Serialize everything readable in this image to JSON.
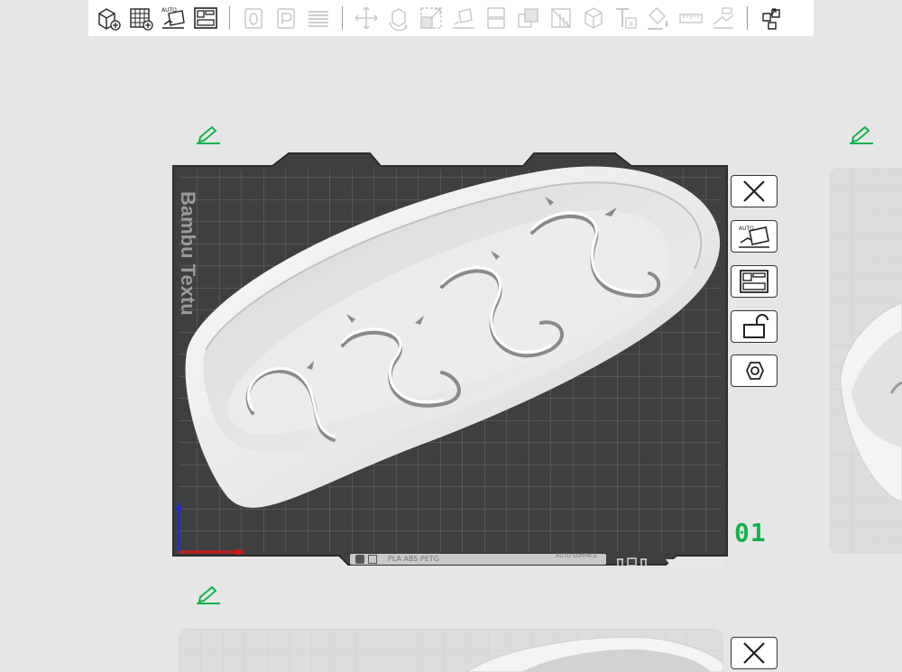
{
  "toolbar": {
    "buttons": [
      {
        "icon": "add-cube-icon",
        "enabled": true
      },
      {
        "icon": "add-plate-icon",
        "enabled": true
      },
      {
        "icon": "auto-orient-icon",
        "enabled": true,
        "text": "AUTO"
      },
      {
        "icon": "arrange-icon",
        "enabled": true
      },
      {
        "icon": "split-objects-icon",
        "enabled": false
      },
      {
        "icon": "split-parts-icon",
        "enabled": false
      },
      {
        "icon": "layers-icon",
        "enabled": false
      },
      {
        "icon": "move-icon",
        "enabled": false
      },
      {
        "icon": "rotate-icon",
        "enabled": false
      },
      {
        "icon": "scale-icon",
        "enabled": false
      },
      {
        "icon": "lay-on-face-icon",
        "enabled": false
      },
      {
        "icon": "cut-icon",
        "enabled": false
      },
      {
        "icon": "boolean-icon",
        "enabled": false
      },
      {
        "icon": "support-paint-icon",
        "enabled": false
      },
      {
        "icon": "seam-paint-icon",
        "enabled": false
      },
      {
        "icon": "text-emboss-icon",
        "enabled": false
      },
      {
        "icon": "color-paint-icon",
        "enabled": false
      },
      {
        "icon": "measure-icon",
        "enabled": false
      },
      {
        "icon": "assembly-icon",
        "enabled": false
      },
      {
        "icon": "explode-view-icon",
        "enabled": true
      }
    ]
  },
  "plate": {
    "label": "Bambu Textu",
    "number": "01",
    "number_color": "#16b14a",
    "filaments_text": "PLA ABS PETG",
    "mode_text": "AUTO SURFACE"
  },
  "plate_buttons": [
    {
      "icon": "close-icon"
    },
    {
      "icon": "auto-orient-icon",
      "text": "AUTO"
    },
    {
      "icon": "arrange-icon"
    },
    {
      "icon": "unlock-icon"
    },
    {
      "icon": "plate-settings-icon"
    }
  ],
  "colors": {
    "accent_green": "#16b14a",
    "bed_dark": "#3e4040",
    "grid_line": "#6a6c6c",
    "model_white": "#f2f2f2",
    "toolbar_bg": "#ffffff",
    "canvas_bg": "#e6e6e6"
  }
}
